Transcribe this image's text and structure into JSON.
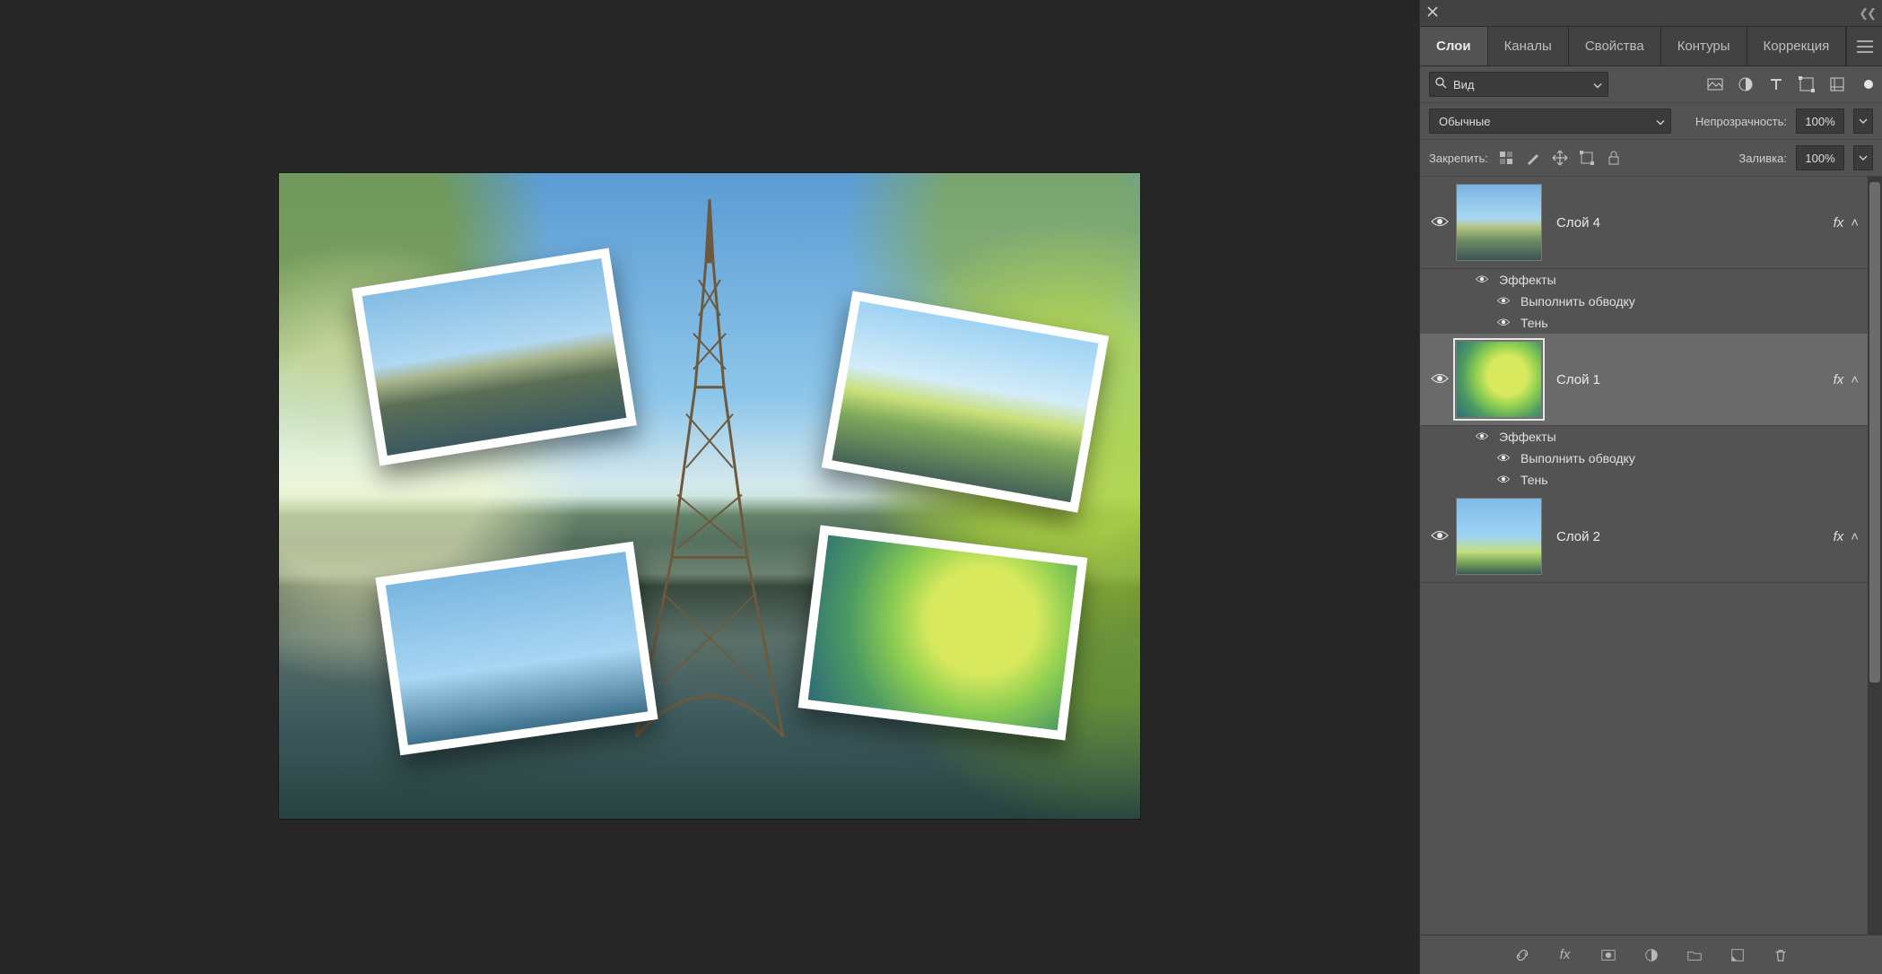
{
  "tabs": [
    "Слои",
    "Каналы",
    "Свойства",
    "Контуры",
    "Коррекция"
  ],
  "active_tab_index": 0,
  "search": {
    "label": "Вид"
  },
  "filter_icons": [
    "image-icon",
    "adjust-icon",
    "type-icon",
    "shape-icon",
    "smart-icon"
  ],
  "blend": {
    "label": "Обычные"
  },
  "opacity": {
    "label": "Непрозрачность:",
    "value": "100%"
  },
  "lock": {
    "label": "Закрепить:"
  },
  "lock_icons": [
    "lock-pixels-icon",
    "lock-brush-icon",
    "lock-move-icon",
    "lock-artboard-icon",
    "lock-all-icon"
  ],
  "fill": {
    "label": "Заливка:",
    "value": "100%"
  },
  "layers": [
    {
      "name": "Слой 4",
      "thumb": "paris",
      "selected": false,
      "fx": true,
      "effects": {
        "header": "Эффекты",
        "items": [
          "Выполнить обводку",
          "Тень"
        ]
      }
    },
    {
      "name": "Слой 1",
      "thumb": "greens",
      "selected": true,
      "fx": true,
      "effects": {
        "header": "Эффекты",
        "items": [
          "Выполнить обводку",
          "Тень"
        ]
      }
    },
    {
      "name": "Слой 2",
      "thumb": "sky",
      "selected": false,
      "fx": true
    }
  ],
  "fx_badge": "fx",
  "footer_icons": [
    "link-icon",
    "fx-icon",
    "mask-icon",
    "adjustment-icon",
    "group-icon",
    "new-layer-icon",
    "trash-icon"
  ]
}
